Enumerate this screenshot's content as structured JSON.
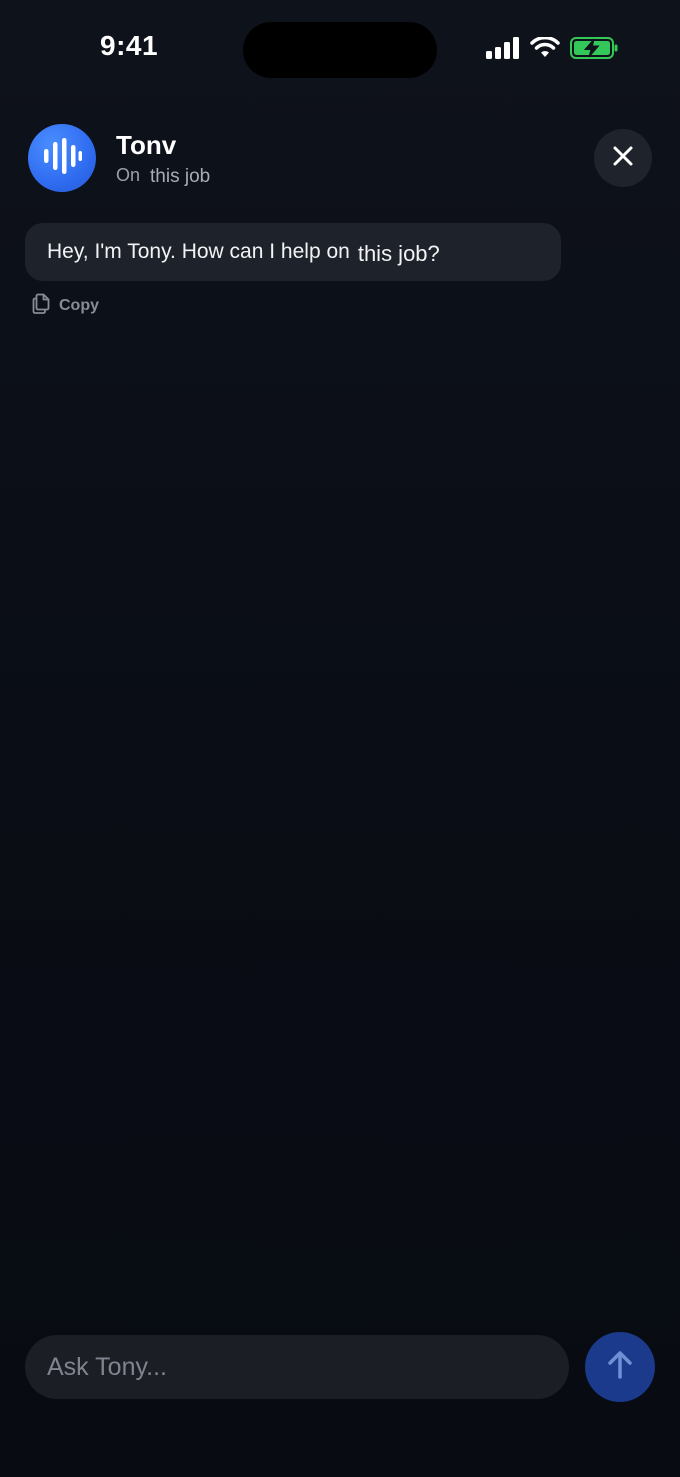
{
  "status_bar": {
    "time": "9:41",
    "icons": [
      "signal-icon",
      "wifi-icon",
      "battery-charging-icon"
    ],
    "battery_color": "#34c759"
  },
  "header": {
    "name": "Tonv",
    "status": "On",
    "context": "this job",
    "avatar_icon": "audio-wave-icon",
    "accent_color": "#2f6cf0"
  },
  "messages": [
    {
      "text": "Hey, I'm Tony. How can I help on",
      "tail": "this job?",
      "action_label": "Copy"
    }
  ],
  "composer": {
    "placeholder": "Ask Tony...",
    "value": "",
    "send_icon": "arrow-up-icon"
  }
}
